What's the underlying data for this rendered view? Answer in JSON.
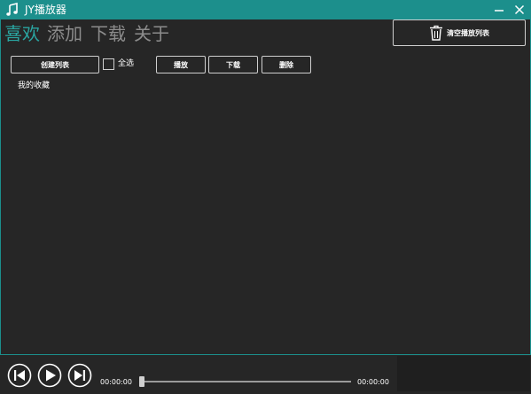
{
  "window": {
    "title": "JY播放器",
    "accent_color": "#1c8f8c"
  },
  "tabs": [
    {
      "label": "喜欢",
      "active": true
    },
    {
      "label": "添加",
      "active": false
    },
    {
      "label": "下载",
      "active": false
    },
    {
      "label": "关于",
      "active": false
    }
  ],
  "toolbar": {
    "clear_playlist": "清空播放列表",
    "create_list": "创建列表",
    "select_all": "全选",
    "play": "播放",
    "download": "下载",
    "delete": "删除"
  },
  "list": {
    "items": [
      "我的收藏"
    ]
  },
  "player": {
    "current_time": "00:00:00",
    "total_time": "00:00:00",
    "progress": 0
  },
  "icons": {
    "app": "music-note-icon",
    "minimize": "minimize-icon",
    "close": "close-icon",
    "trash": "trash-icon",
    "previous": "previous-icon",
    "play": "play-icon",
    "next": "next-icon"
  }
}
